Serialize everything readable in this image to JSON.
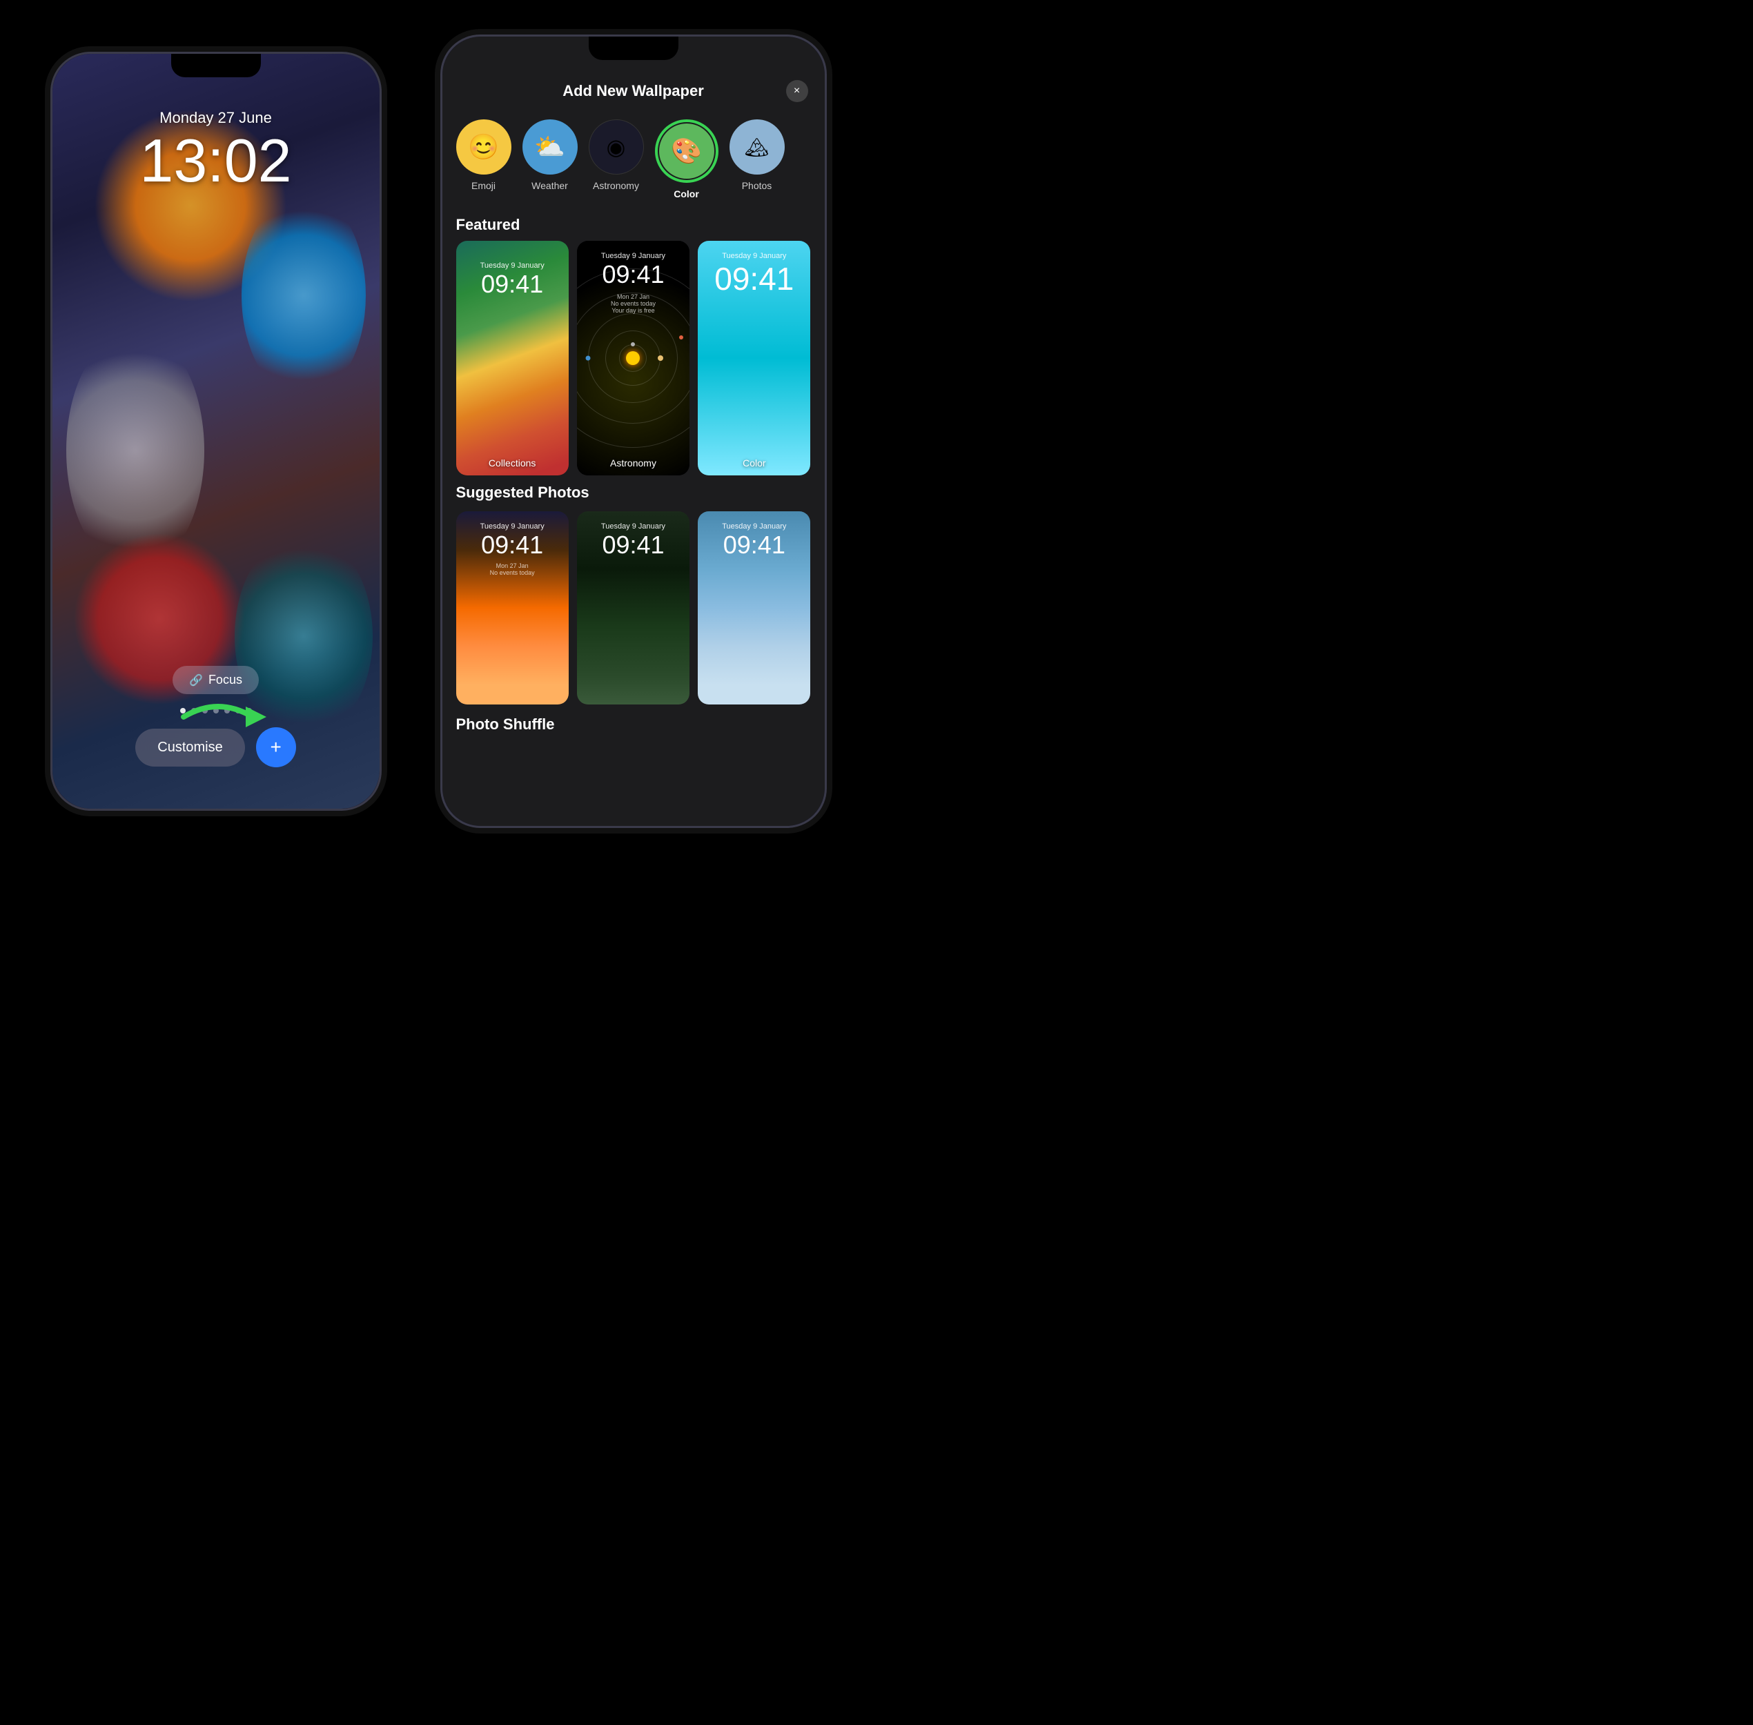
{
  "left_phone": {
    "date": "Monday 27 June",
    "time": "13:02",
    "focus_label": "Focus",
    "customise_label": "Customise",
    "dots": [
      1,
      0,
      0,
      0,
      0,
      0,
      0
    ]
  },
  "right_phone": {
    "panel_title": "Add New Wallpaper",
    "close_label": "×",
    "wallpaper_types": [
      {
        "id": "emoji",
        "label": "Emoji",
        "icon": "😊",
        "selected": false
      },
      {
        "id": "weather",
        "label": "Weather",
        "icon": "⛅",
        "selected": false
      },
      {
        "id": "astronomy",
        "label": "Astronomy",
        "icon": "🔭",
        "selected": false
      },
      {
        "id": "color",
        "label": "Color",
        "icon": "🎨",
        "selected": true
      },
      {
        "id": "photos",
        "label": "Photos",
        "icon": "📷",
        "selected": false
      }
    ],
    "featured_title": "Featured",
    "featured_cards": [
      {
        "id": "collections",
        "label": "Collections",
        "date": "Tuesday 9 January",
        "time": "09:41"
      },
      {
        "id": "astronomy",
        "label": "Astronomy",
        "date": "Tuesday 9 January",
        "time": "09:41"
      },
      {
        "id": "color",
        "label": "Color",
        "date": "Tuesday 9 January",
        "time": "09:41"
      }
    ],
    "suggested_title": "Suggested Photos",
    "suggested_cards": [
      {
        "id": "sunset",
        "date": "Tuesday 9 January",
        "time": "09:41"
      },
      {
        "id": "forest",
        "date": "Tuesday 9 January",
        "time": "09:41"
      },
      {
        "id": "mountain",
        "date": "Tuesday 9 January",
        "time": "09:41"
      }
    ],
    "photo_shuffle_title": "Photo Shuffle"
  },
  "colors": {
    "green_arrow": "#39d353",
    "plus_btn": "#2979ff",
    "selected_border": "#39d353"
  }
}
